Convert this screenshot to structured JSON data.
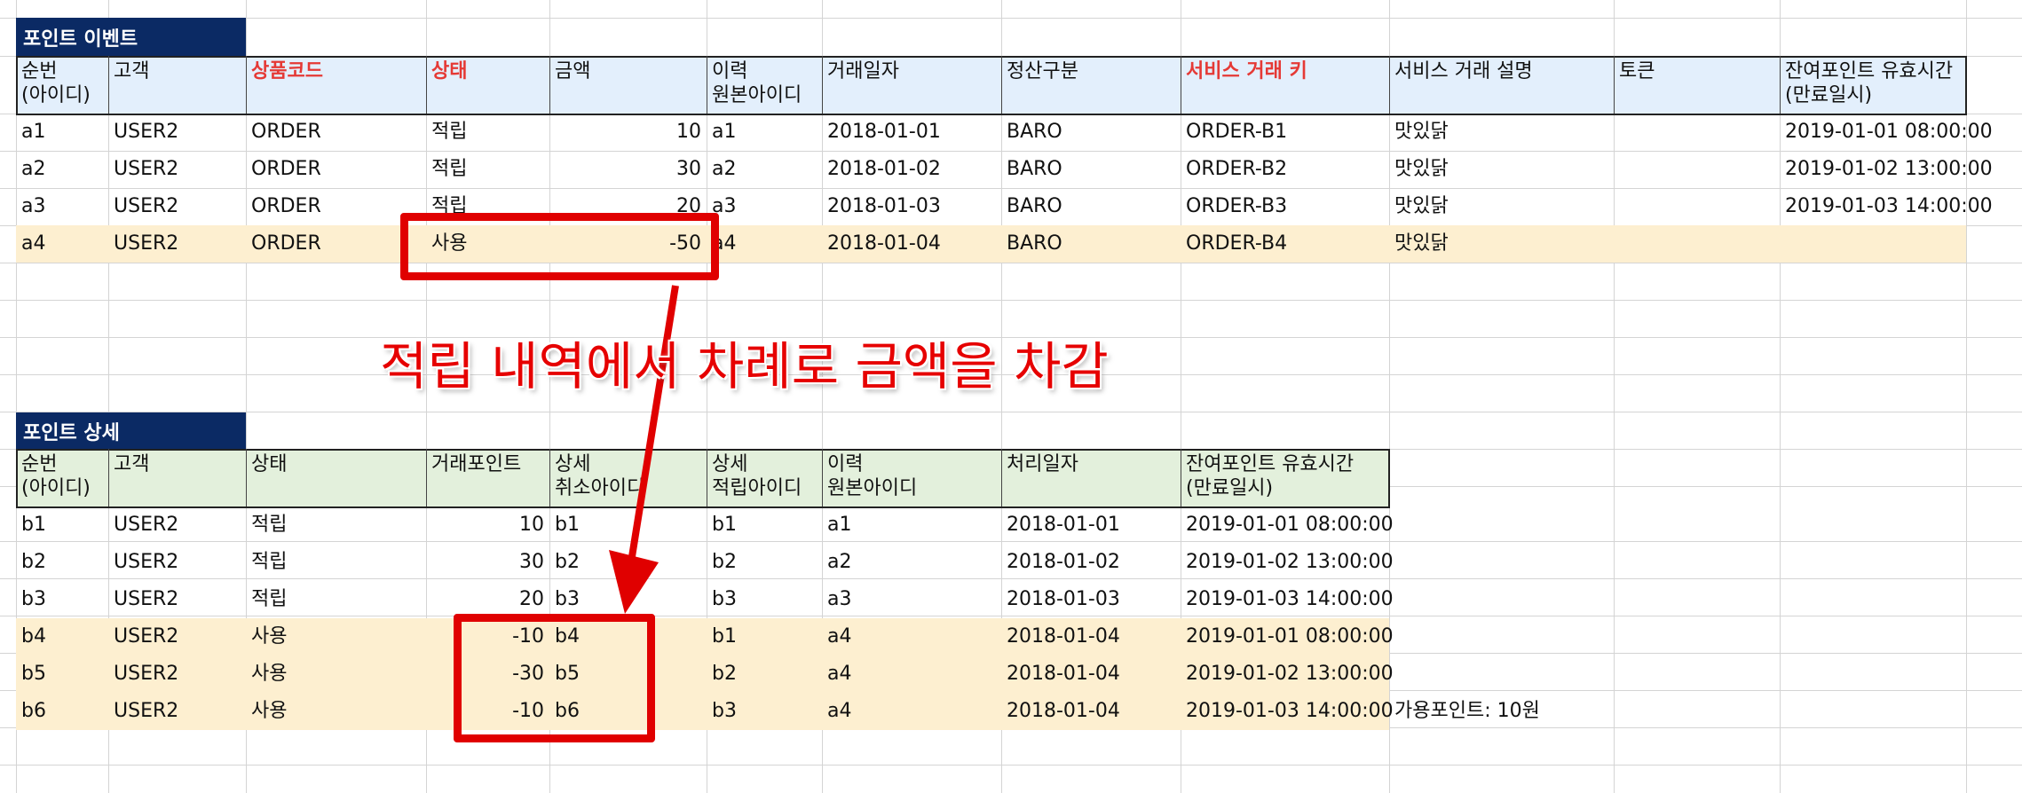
{
  "event_table": {
    "title": "포인트 이벤트",
    "headers": [
      "순번\n(아이디)",
      "고객",
      "상품코드",
      "상태",
      "금액",
      "이력\n원본아이디",
      "거래일자",
      "정산구분",
      "서비스 거래 키",
      "서비스 거래 설명",
      "토큰",
      "잔여포인트 유효시간\n(만료일시)"
    ],
    "highlighted_headers": [
      2,
      3,
      8
    ],
    "rows": [
      [
        "a1",
        "USER2",
        "ORDER",
        "적립",
        "10",
        "a1",
        "2018-01-01",
        "BARO",
        "ORDER-B1",
        "맛있닭",
        "",
        "2019-01-01 08:00:00"
      ],
      [
        "a2",
        "USER2",
        "ORDER",
        "적립",
        "30",
        "a2",
        "2018-01-02",
        "BARO",
        "ORDER-B2",
        "맛있닭",
        "",
        "2019-01-02 13:00:00"
      ],
      [
        "a3",
        "USER2",
        "ORDER",
        "적립",
        "20",
        "a3",
        "2018-01-03",
        "BARO",
        "ORDER-B3",
        "맛있닭",
        "",
        "2019-01-03 14:00:00"
      ],
      [
        "a4",
        "USER2",
        "ORDER",
        "사용",
        "-50",
        "a4",
        "2018-01-04",
        "BARO",
        "ORDER-B4",
        "맛있닭",
        "",
        ""
      ]
    ],
    "highlighted_rows": [
      3
    ]
  },
  "detail_table": {
    "title": "포인트 상세",
    "headers": [
      "순번\n(아이디)",
      "고객",
      "상태",
      "거래포인트",
      "상세\n취소아이디",
      "상세\n적립아이디",
      "이력\n원본아이디",
      "처리일자",
      "잔여포인트 유효시간\n(만료일시)"
    ],
    "rows": [
      [
        "b1",
        "USER2",
        "적립",
        "10",
        "b1",
        "b1",
        "a1",
        "2018-01-01",
        "2019-01-01 08:00:00"
      ],
      [
        "b2",
        "USER2",
        "적립",
        "30",
        "b2",
        "b2",
        "a2",
        "2018-01-02",
        "2019-01-02 13:00:00"
      ],
      [
        "b3",
        "USER2",
        "적립",
        "20",
        "b3",
        "b3",
        "a3",
        "2018-01-03",
        "2019-01-03 14:00:00"
      ],
      [
        "b4",
        "USER2",
        "사용",
        "-10",
        "b4",
        "b1",
        "a4",
        "2018-01-04",
        "2019-01-01 08:00:00"
      ],
      [
        "b5",
        "USER2",
        "사용",
        "-30",
        "b5",
        "b2",
        "a4",
        "2018-01-04",
        "2019-01-02 13:00:00"
      ],
      [
        "b6",
        "USER2",
        "사용",
        "-10",
        "b6",
        "b3",
        "a4",
        "2018-01-04",
        "2019-01-03 14:00:00"
      ]
    ],
    "highlighted_rows": [
      3,
      4,
      5
    ],
    "side_note": "가용포인트: 10원"
  },
  "annotation": {
    "text": "적립 내역에서 차례로 금액을 차감"
  },
  "colors": {
    "title_bg": "#0b2a64",
    "event_header_bg": "#e3effc",
    "detail_header_bg": "#e3f0dc",
    "highlight_row_bg": "#fdefd0",
    "accent_red": "#e60000",
    "gridline": "#d4d4d4"
  }
}
